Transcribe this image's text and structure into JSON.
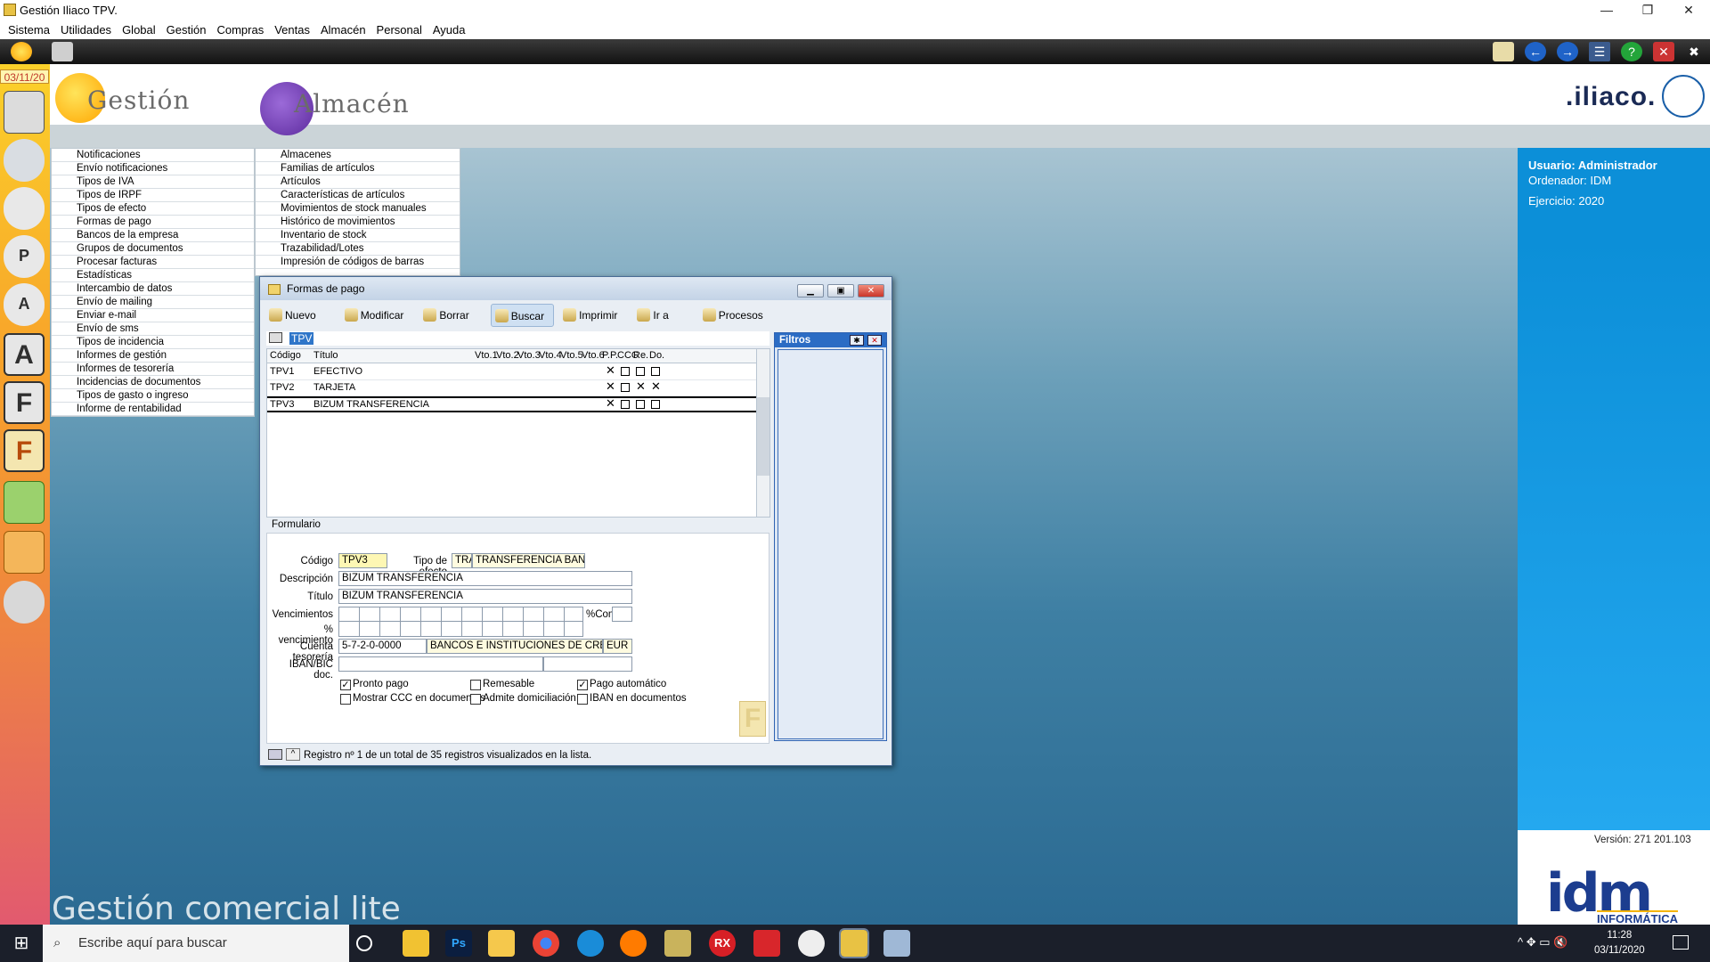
{
  "window": {
    "title": "Gestión Iliaco TPV.",
    "minimize": "—",
    "restore": "❐",
    "close": "✕"
  },
  "menubar": [
    "Sistema",
    "Utilidades",
    "Global",
    "Gestión",
    "Compras",
    "Ventas",
    "Almacén",
    "Personal",
    "Ayuda"
  ],
  "date": "03/11/20",
  "header": {
    "gestion": "Gestión",
    "almacen": "Almacén",
    "brand": ".iliaco."
  },
  "gestion_menu": [
    "Notificaciones",
    "Envío notificaciones",
    "Tipos de IVA",
    "Tipos de IRPF",
    "Tipos de efecto",
    "Formas de pago",
    "Bancos de la empresa",
    "Grupos de documentos",
    "Procesar facturas",
    "Estadísticas",
    "Intercambio de datos",
    "Envío de mailing",
    "Enviar e-mail",
    "Envío de sms",
    "Tipos de incidencia",
    "Informes de gestión",
    "Informes de tesorería",
    "Incidencias de documentos",
    "Tipos de gasto o ingreso",
    "Informe de rentabilidad"
  ],
  "almacen_menu": [
    "Almacenes",
    "Familias de artículos",
    "Artículos",
    "Características de artículos",
    "Movimientos de stock manuales",
    "Histórico de movimientos",
    "Inventario de stock",
    "Trazabilidad/Lotes",
    "Impresión de códigos de barras"
  ],
  "user_panel": {
    "usuario": "Usuario: Administrador",
    "ordenador": "Ordenador: IDM",
    "ejercicio": "Ejercicio: 2020",
    "version": "Versión: 271 201.103",
    "idm": "idm",
    "idm_tag": "INFORMÁTICA"
  },
  "subtitle": "Gestión comercial lite",
  "dialog": {
    "title": "Formas de pago",
    "toolbar": [
      "Nuevo",
      "Modificar",
      "Borrar",
      "Buscar",
      "Imprimir",
      "Ir a",
      "Procesos"
    ],
    "search_tag": "TPV",
    "columns": [
      "Código",
      "Título",
      "Vto.1",
      "Vto.2",
      "Vto.3",
      "Vto.4",
      "Vto.5",
      "Vto.6",
      "P.P.",
      "CCC",
      "Re.",
      "Do."
    ],
    "rows": [
      {
        "codigo": "TPV1",
        "titulo": "EFECTIVO",
        "pp": "✕",
        "ccc": "",
        "re": "",
        "do": ""
      },
      {
        "codigo": "TPV2",
        "titulo": "TARJETA",
        "pp": "✕",
        "ccc": "",
        "re": "✕",
        "do": "✕"
      },
      {
        "codigo": "TPV3",
        "titulo": "BIZUM TRANSFERENCIA",
        "pp": "✕",
        "ccc": "",
        "re": "",
        "do": ""
      }
    ],
    "filtros": "Filtros",
    "form_tab": "Formulario",
    "form": {
      "codigo_label": "Código",
      "codigo": "TPV3",
      "tipo_efecto_label": "Tipo de efecto",
      "tipo_efecto_code": "TRA",
      "tipo_efecto_desc": "TRANSFERENCIA BANCARIA",
      "descripcion_label": "Descripción",
      "descripcion": "BIZUM TRANSFERENCIA",
      "titulo_label": "Título",
      "titulo": "BIZUM TRANSFERENCIA",
      "vencimientos_label": "Vencimientos",
      "pct_venc_label": "% vencimiento",
      "pct_com_label": "%Com.",
      "cuenta_label": "Cuenta tesorería",
      "cuenta": "5-7-2-0-0000",
      "cuenta_desc": "BANCOS E INSTITUCIONES DE CREDITO C/C V",
      "cuenta_moneda": "EUR",
      "iban_label": "IBAN/BIC doc.",
      "checks": [
        {
          "label": "Pronto pago",
          "checked": true
        },
        {
          "label": "Remesable",
          "checked": false
        },
        {
          "label": "Pago automático",
          "checked": true
        },
        {
          "label": "Mostrar CCC en documentos",
          "checked": false
        },
        {
          "label": "Admite domiciliación",
          "checked": false
        },
        {
          "label": "IBAN en documentos",
          "checked": false
        }
      ]
    },
    "status": "Registro nº 1 de un total de 35 registros visualizados en la lista."
  },
  "taskbar": {
    "search_placeholder": "Escribe aquí para buscar",
    "time": "11:28",
    "date": "03/11/2020"
  }
}
